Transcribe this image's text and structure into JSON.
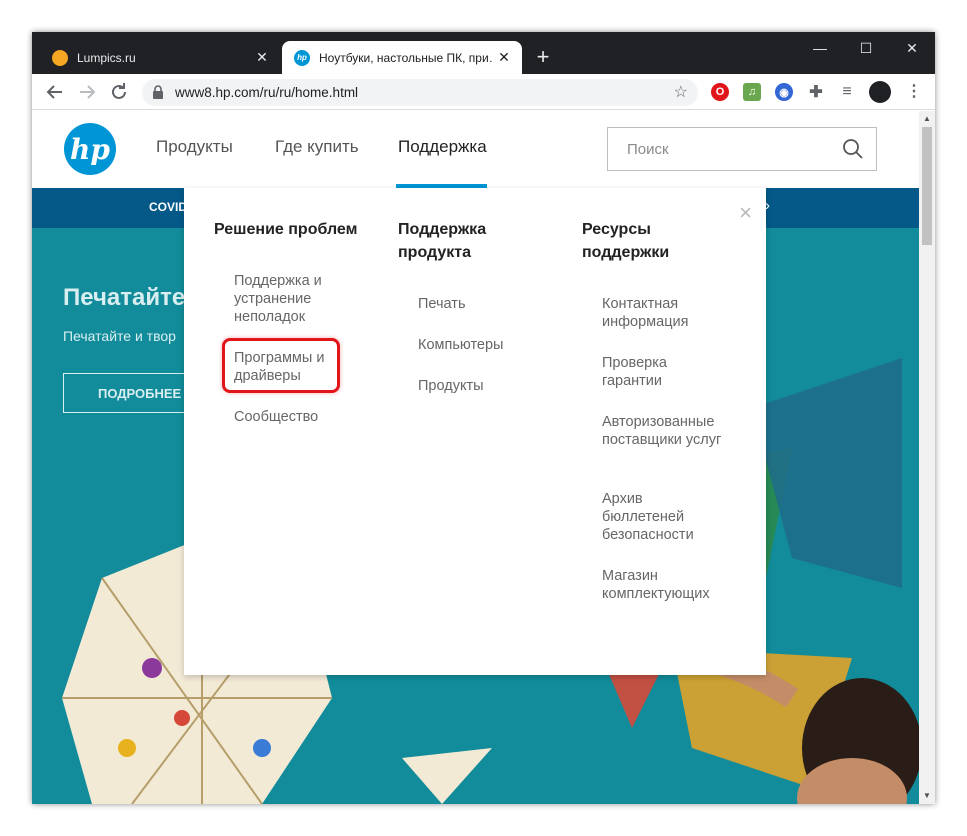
{
  "browser": {
    "tabs": [
      {
        "title": "Lumpics.ru",
        "favicon_color": "#f5a623",
        "active": false
      },
      {
        "title": "Ноутбуки, настольные ПК, при…",
        "favicon_color": "#0096d6",
        "favicon_text": "hp",
        "active": true
      }
    ],
    "new_tab_label": "+",
    "window_controls": {
      "minimize": "—",
      "maximize": "☐",
      "close": "✕"
    },
    "url": "www8.hp.com/ru/ru/home.html",
    "nav_icons": [
      "back-arrow-icon",
      "forward-arrow-icon",
      "reload-icon",
      "lock-icon",
      "bookmark-star-icon"
    ],
    "extensions": [
      {
        "name": "opera-icon",
        "color": "#e0161b",
        "glyph": "O"
      },
      {
        "name": "music-icon",
        "color": "#6aa84f",
        "glyph": "♫"
      },
      {
        "name": "vpn-globe-icon",
        "color": "#3367d6",
        "glyph": "◉"
      },
      {
        "name": "puzzle-icon",
        "color": "#5f6368",
        "glyph": "✚"
      },
      {
        "name": "media-queue-icon",
        "color": "#5f6368",
        "glyph": "≡"
      },
      {
        "name": "profile-avatar-icon",
        "color": "#202124",
        "glyph": ""
      }
    ],
    "menu_glyph": "⋮"
  },
  "hp": {
    "logo_text": "hp",
    "nav": {
      "products": "Продукты",
      "where_to_buy": "Где купить",
      "support": "Поддержка"
    },
    "search_placeholder": "Поиск",
    "banner_text": "COVID",
    "banner_chevron": "›",
    "hero": {
      "title": "Печатайте",
      "subtitle": "Печатайте и твор",
      "button": "ПОДРОБНЕЕ"
    }
  },
  "support_menu": {
    "close_glyph": "×",
    "columns": [
      {
        "heading": "Решение проблем",
        "items": [
          "Поддержка и устранение неполадок",
          "Программы и драйверы",
          "Сообщество"
        ]
      },
      {
        "heading": "Поддержка продукта",
        "items": [
          "Печать",
          "Компьютеры",
          "Продукты"
        ]
      },
      {
        "heading": "Ресурсы поддержки",
        "items": [
          "Контактная информация",
          "Проверка гарантии",
          "Авторизованные поставщики услуг",
          "Архив бюллетеней безопасности",
          "Магазин комплектующих"
        ]
      }
    ],
    "highlighted_item": "Программы и драйверы",
    "highlight_color": "#e0161b"
  }
}
